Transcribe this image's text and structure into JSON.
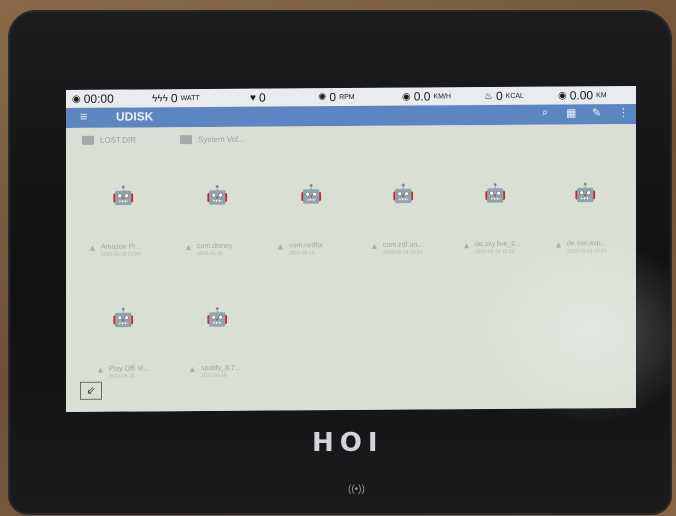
{
  "status": {
    "time": "00:00",
    "watt_value": "0",
    "watt_unit": "WATT",
    "heart_value": "0",
    "rpm_value": "0",
    "rpm_unit": "RPM",
    "speed_value": "0.0",
    "speed_unit": "KM/H",
    "kcal_value": "0",
    "kcal_unit": "KCAL",
    "distance_value": "0.00",
    "distance_unit": "KM"
  },
  "appbar": {
    "title": "UDISK"
  },
  "folders": [
    {
      "label": "LOST.DIR"
    },
    {
      "label": "System Vol..."
    }
  ],
  "apks": [
    {
      "name": "Amazon Pr...",
      "meta": "2023-05-16 01:54"
    },
    {
      "name": "com.disney",
      "meta": "2023-05-16"
    },
    {
      "name": "com.netflix",
      "meta": "2023-05-16"
    },
    {
      "name": "com.zdf.an...",
      "meta": "2023-05-16 12:24"
    },
    {
      "name": "de.sky.live_2...",
      "meta": "2023-05-16 11:28"
    },
    {
      "name": "de.swr.avp...",
      "meta": "2023-05-16 12:24"
    },
    {
      "name": "Play Offi Vi...",
      "meta": "2023-05-16"
    },
    {
      "name": "spotify_8.7...",
      "meta": "2023-05-16"
    }
  ],
  "brand": "HOI",
  "icons": {
    "clock": "clock-icon",
    "watt": "lightning-icon",
    "heart": "heart-icon",
    "rpm": "rpm-icon",
    "speed": "speed-icon",
    "kcal": "flame-icon",
    "distance": "distance-icon",
    "apk": "android-icon",
    "nfc": "nfc-icon"
  },
  "colors": {
    "appbar": "#5c86c2",
    "screen": "#d9dfd5",
    "bezel": "#141416"
  }
}
